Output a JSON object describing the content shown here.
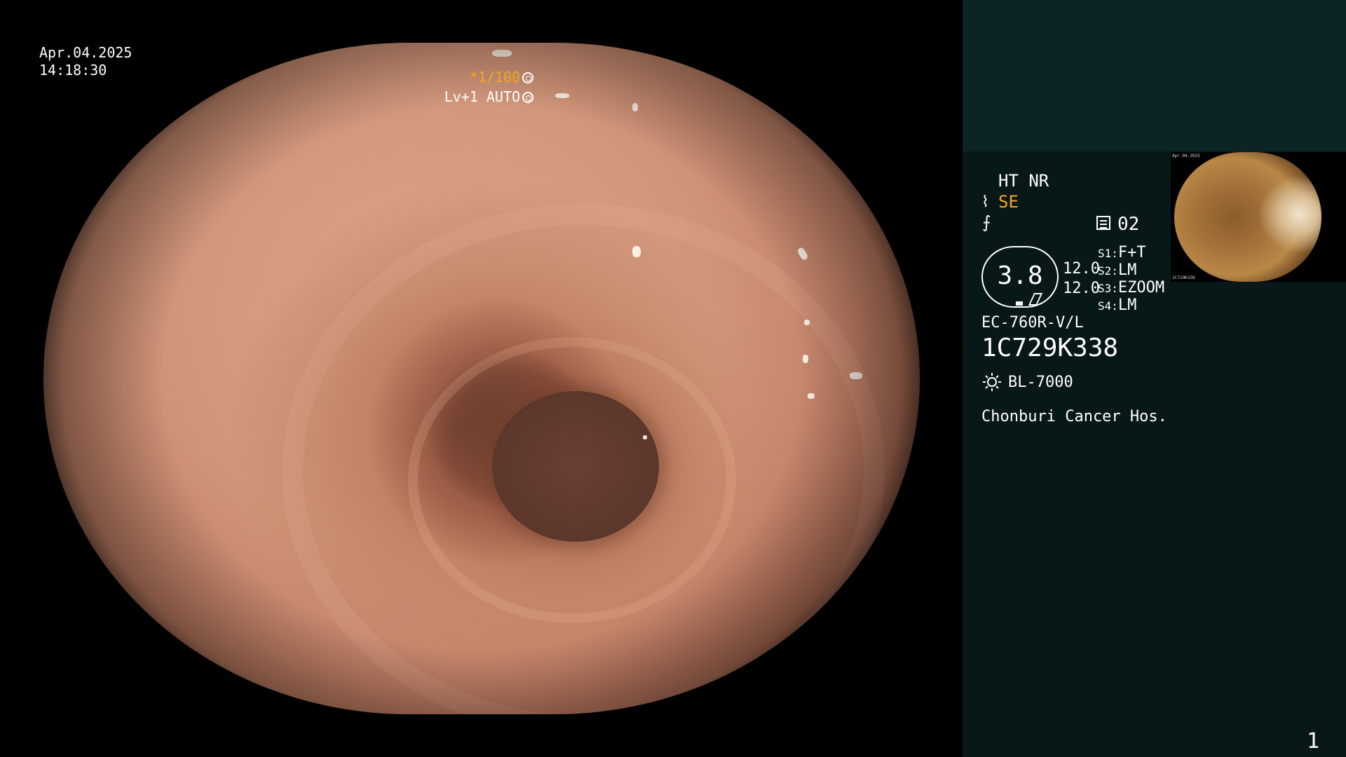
{
  "overlay": {
    "date": "Apr.04.2025",
    "time": "14:18:30",
    "shutter": "*1/100",
    "level": "Lv+1 AUTO"
  },
  "panel": {
    "mode": "HT NR",
    "se": "SE",
    "monitor_num": "02",
    "gauge_value": "3.8",
    "value1": "12.0",
    "value2": "12.0",
    "s_keys": {
      "s1": "S1:",
      "s2": "S2:",
      "s3": "S3:",
      "s4": "S4:"
    },
    "s_values": {
      "s1": "F+T",
      "s2": "LM",
      "s3": "EZOOM",
      "s4": "LM"
    },
    "scope_model": "EC-760R-V/L",
    "serial": "1C729K338",
    "light_source": "BL-7000",
    "hospital": "Chonburi Cancer Hos.",
    "page_number": "1"
  },
  "colors": {
    "accent_orange": "#f5a623",
    "panel_top_bg": "#0c2426",
    "panel_bg": "#081718",
    "text": "#ffffff"
  },
  "icons": [
    "shutter-icon",
    "auto-icon",
    "structure-enhance-icon",
    "noise-reduction-icon",
    "monitor-icon",
    "light-source-icon"
  ]
}
